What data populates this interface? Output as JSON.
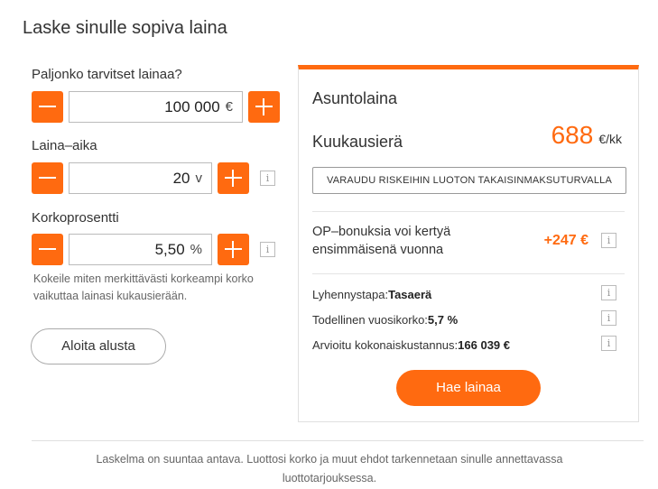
{
  "title": "Laske sinulle sopiva laina",
  "amount": {
    "label": "Paljonko tarvitset lainaa?",
    "value": "100 000",
    "unit": "€"
  },
  "term": {
    "label": "Laina–aika",
    "value": "20",
    "unit": "v"
  },
  "rate": {
    "label": "Korkoprosentti",
    "value": "5,50",
    "unit": "%"
  },
  "hint": "Kokeile miten merkittävästi korkeampi korko vaikuttaa lainasi kukausierään.",
  "reset_label": "Aloita alusta",
  "panel": {
    "title": "Asuntolaina",
    "monthly_label": "Kuukausierä",
    "monthly_value": "688",
    "monthly_unit": "€/kk",
    "insure_label": "VARAUDU RISKEIHIN LUOTON TAKAISINMAKSUTURVALLA",
    "bonus_text": "OP–bonuksia voi kertyä ensimmäisenä vuonna",
    "bonus_value": "+247 €",
    "repayment_label": "Lyhennystapa:",
    "repayment_value": "Tasaerä",
    "apr_label": "Todellinen vuosikorko:",
    "apr_value": "5,7 %",
    "total_label": "Arvioitu kokonaiskustannus:",
    "total_value": "166 039 €",
    "apply_label": "Hae lainaa"
  },
  "info_glyph": "i",
  "footer": "Laskelma on suuntaa antava. Luottosi korko ja muut ehdot tarkennetaan sinulle annettavassa luottotarjouksessa.",
  "accent_color": "#ff6a10"
}
